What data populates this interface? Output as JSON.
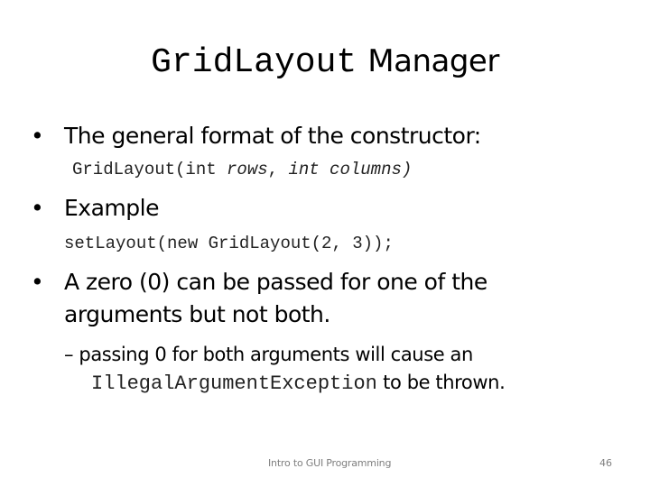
{
  "slide": {
    "title_code": "GridLayout",
    "title_text": "Manager",
    "bullets": [
      {
        "marker": "•",
        "text": "The general format of the constructor:",
        "code_plain_1": "GridLayout(int ",
        "code_italic_1": "rows",
        "code_plain_2": ", ",
        "code_italic_2": "int columns)"
      },
      {
        "marker": "•",
        "text": "Example",
        "code": "setLayout(new GridLayout(2, 3));"
      },
      {
        "marker": "•",
        "line1": "A zero (0) can be passed for one of the",
        "line2": "arguments but not both."
      }
    ],
    "sub_bullet": {
      "marker": "–",
      "line1": "passing 0 for both arguments will cause an",
      "line2_code": "IllegalArgumentException",
      "line2_text": " to be thrown."
    },
    "footer": {
      "center": "Intro to GUI Programming",
      "page_number": "46"
    }
  }
}
